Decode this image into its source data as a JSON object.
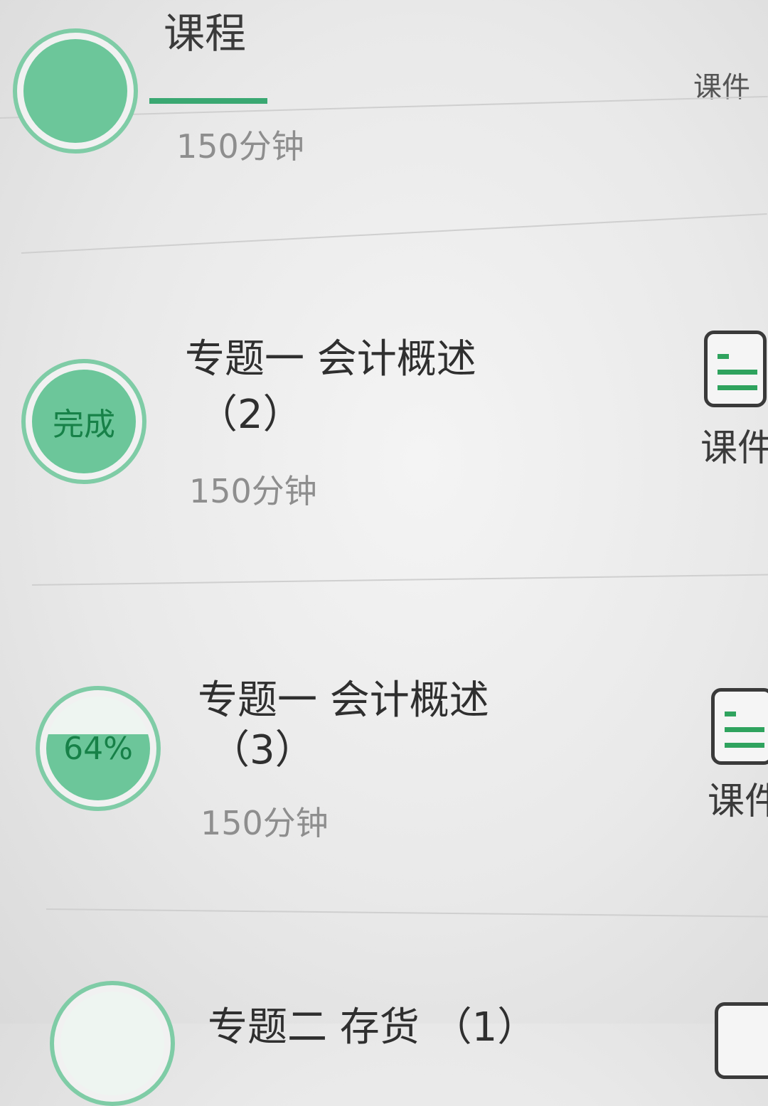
{
  "tabs": {
    "course": "课程",
    "courseware_partial": "课件"
  },
  "rows": [
    {
      "duration": "150分钟"
    },
    {
      "title_line1": "专题一 会计概述",
      "title_line2": "（2）",
      "duration": "150分钟",
      "status": "完成",
      "progress": 1.0,
      "courseware_label": "课件"
    },
    {
      "title_line1": "专题一 会计概述",
      "title_line2": "（3）",
      "duration": "150分钟",
      "status": "64%",
      "progress": 0.64,
      "courseware_label": "课件"
    },
    {
      "title_line1": "专题二 存货 （1）"
    }
  ],
  "colors": {
    "accent": "#3aa872",
    "fill": "#6cc69a",
    "ring": "#7fcca6"
  },
  "icons": {
    "courseware": "document-list-icon"
  }
}
